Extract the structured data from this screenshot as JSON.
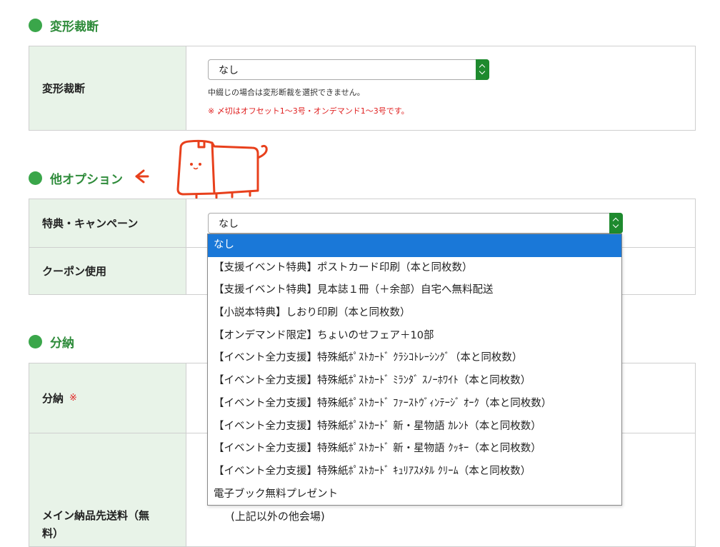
{
  "sections": {
    "deform": {
      "title": "変形裁断",
      "label": "変形裁断",
      "select_value": "なし",
      "note1": "中綴じの場合は変形断裁を選択できません。",
      "note2": "※ 〆切はオフセット1～3号・オンデマンド1～3号です。"
    },
    "options": {
      "title": "他オプション",
      "perk_label": "特典・キャンペーン",
      "perk_value": "なし",
      "coupon_label": "クーポン使用"
    },
    "delivery": {
      "title": "分納",
      "label": "分納",
      "required_mark": "※",
      "main_label_line1": "メイン納品先送料（無",
      "main_label_line2": "料）",
      "other_venue": "(上記以外の他会場)"
    }
  },
  "dropdown": {
    "options": [
      "なし",
      "【支援イベント特典】ポストカード印刷（本と同枚数）",
      "【支援イベント特典】見本誌１冊（＋余部）自宅へ無料配送",
      "【小説本特典】しおり印刷（本と同枚数）",
      "【オンデマンド限定】ちょいのせフェア＋10部",
      "【イベント全力支援】特殊紙ﾎﾟｽﾄｶｰﾄﾞ ｸﾗｼｺﾄﾚｰｼﾝｸﾞ（本と同枚数）",
      "【イベント全力支援】特殊紙ﾎﾟｽﾄｶｰﾄﾞ ﾐﾗﾝﾀﾞ ｽﾉｰﾎﾜｲﾄ（本と同枚数）",
      "【イベント全力支援】特殊紙ﾎﾟｽﾄｶｰﾄﾞ ﾌｧｰｽﾄｳﾞｨﾝﾃｰｼﾞ ｵｰｸ（本と同枚数）",
      "【イベント全力支援】特殊紙ﾎﾟｽﾄｶｰﾄﾞ 新・星物語 ｶﾚﾝﾄ（本と同枚数）",
      "【イベント全力支援】特殊紙ﾎﾟｽﾄｶｰﾄﾞ 新・星物語 ｸｯｷｰ（本と同枚数）",
      "【イベント全力支援】特殊紙ﾎﾟｽﾄｶｰﾄﾞ ｷｭﾘｱｽﾒﾀﾙ ｸﾘｰﾑ（本と同枚数）",
      "電子ブック無料プレゼント"
    ],
    "selected_index": 0
  },
  "colors": {
    "accent_green": "#2e8b3a",
    "label_bg": "#e8f3e8",
    "select_arrow": "#1e8a2e",
    "selected_option": "#1a78d8",
    "note_red": "#e02020",
    "cat_orange": "#e8401c"
  },
  "icons": {
    "section_bullet": "green-dot-icon",
    "select_arrow": "updown-chevron-icon",
    "pointer": "left-arrow-icon",
    "mascot": "box-cat-mascot"
  }
}
